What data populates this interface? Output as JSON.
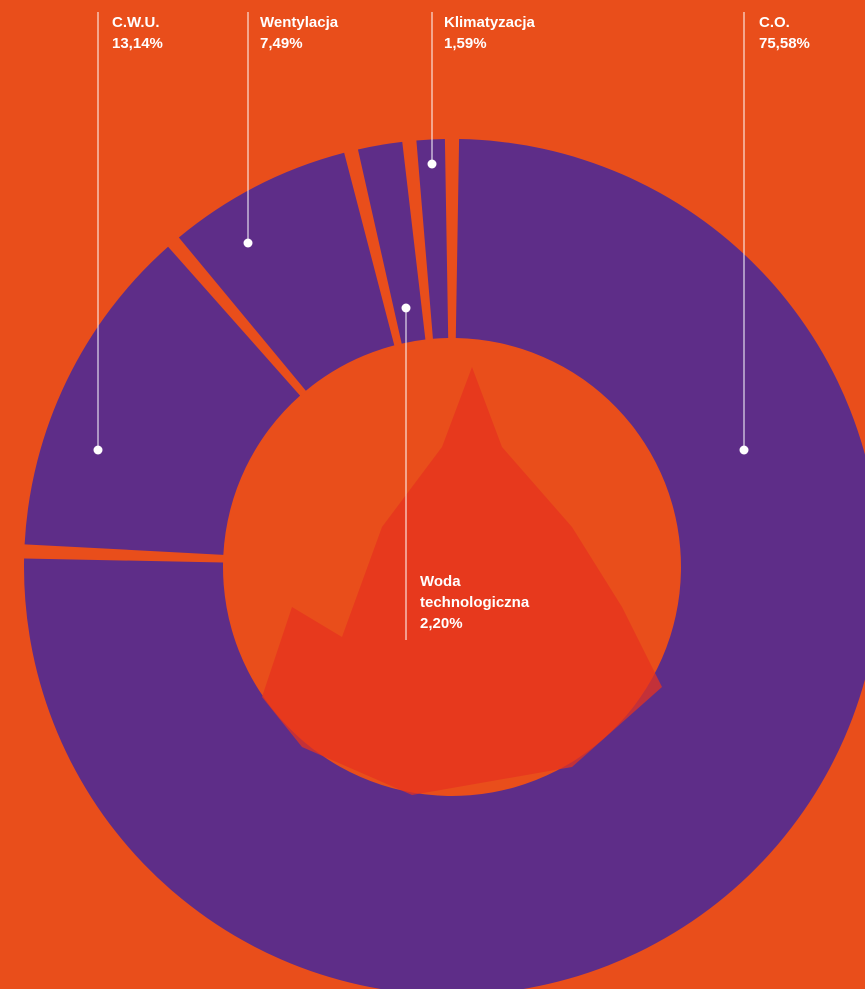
{
  "chart_data": {
    "type": "pie",
    "donut": true,
    "start": "top, clockwise",
    "slices": [
      {
        "name": "C.O.",
        "value_label": "75,58%",
        "value": 75.58
      },
      {
        "name": "C.W.U.",
        "value_label": "13,14%",
        "value": 13.14
      },
      {
        "name": "Wentylacja",
        "value_label": "7,49%",
        "value": 7.49
      },
      {
        "name": "Woda technologiczna",
        "value_label": "2,20%",
        "value": 2.2
      },
      {
        "name": "Klimatyzacja",
        "value_label": "1,59%",
        "value": 1.59
      }
    ],
    "legend": "callout labels with leader lines"
  },
  "colors": {
    "background": "#E94E1B",
    "slice": "#5E2D88",
    "center": "#E94E1B",
    "center_photo_tint": "#E5331F",
    "text": "#FFFFFF",
    "leader": "#FFFFFF"
  }
}
